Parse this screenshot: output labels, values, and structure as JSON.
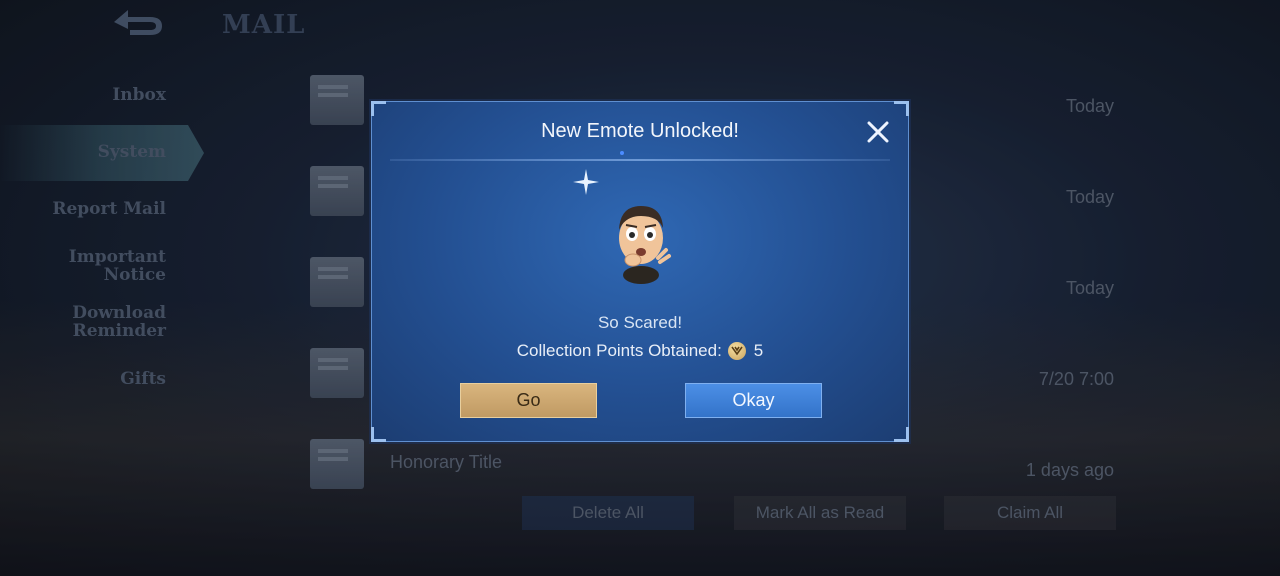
{
  "header": {
    "title": "MAIL",
    "back_icon": "back-arrow-icon"
  },
  "sidebar": {
    "items": [
      {
        "label": "Inbox"
      },
      {
        "label": "System",
        "active": true
      },
      {
        "label": "Report Mail"
      },
      {
        "label": "Important\nNotice"
      },
      {
        "label": "Download\nReminder"
      },
      {
        "label": "Gifts"
      }
    ]
  },
  "mail_list": [
    {
      "subject": "",
      "date": "Today"
    },
    {
      "subject": "",
      "date": "Today"
    },
    {
      "subject": "",
      "date": "Today"
    },
    {
      "subject": "",
      "date": "7/20 7:00"
    },
    {
      "subject": "Honorary Title",
      "date": "1 days ago"
    }
  ],
  "actions": {
    "delete_all": "Delete All",
    "mark_all_read": "Mark All as Read",
    "claim_all": "Claim All"
  },
  "modal": {
    "title": "New Emote Unlocked!",
    "emote_name": "So Scared!",
    "points_label": "Collection Points Obtained:",
    "points_value": "5",
    "go_label": "Go",
    "okay_label": "Okay"
  },
  "colors": {
    "modal_bg": "#2f68b4",
    "go_button": "#d9b57e",
    "okay_button": "#4c8fe6"
  }
}
